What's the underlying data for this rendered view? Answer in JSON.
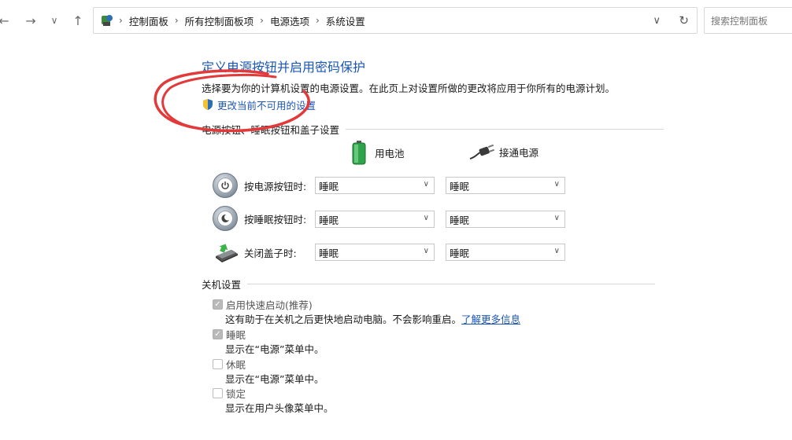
{
  "nav": {
    "breadcrumbs": [
      "控制面板",
      "所有控制面板项",
      "电源选项",
      "系统设置"
    ],
    "search_placeholder": "搜索控制面板"
  },
  "page": {
    "title": "定义电源按钮并启用密码保护",
    "description": "选择要为你的计算机设置的电源设置。在此页上对设置所做的更改将应用于你所有的电源计划。",
    "change_link": "更改当前不可用的设置"
  },
  "buttons_section": {
    "heading": "电源按钮、睡眠按钮和盖子设置",
    "col_battery": "用电池",
    "col_plugged": "接通电源",
    "rows": [
      {
        "label": "按电源按钮时:",
        "battery": "睡眠",
        "plugged": "睡眠"
      },
      {
        "label": "按睡眠按钮时:",
        "battery": "睡眠",
        "plugged": "睡眠"
      },
      {
        "label": "关闭盖子时:",
        "battery": "睡眠",
        "plugged": "睡眠"
      }
    ]
  },
  "shutdown_section": {
    "heading": "关机设置",
    "items": [
      {
        "label": "启用快速启动(推荐)",
        "checked": true,
        "disabled": true,
        "desc": "这有助于在关机之后更快地启动电脑。不会影响重启。",
        "link": "了解更多信息"
      },
      {
        "label": "睡眠",
        "checked": true,
        "disabled": true,
        "desc": "显示在“电源”菜单中。"
      },
      {
        "label": "休眠",
        "checked": false,
        "disabled": true,
        "desc": "显示在“电源”菜单中。"
      },
      {
        "label": "锁定",
        "checked": false,
        "disabled": true,
        "desc": "显示在用户头像菜单中。"
      }
    ]
  },
  "colors": {
    "link": "#1a56b6",
    "annotation": "#e23a3a"
  }
}
